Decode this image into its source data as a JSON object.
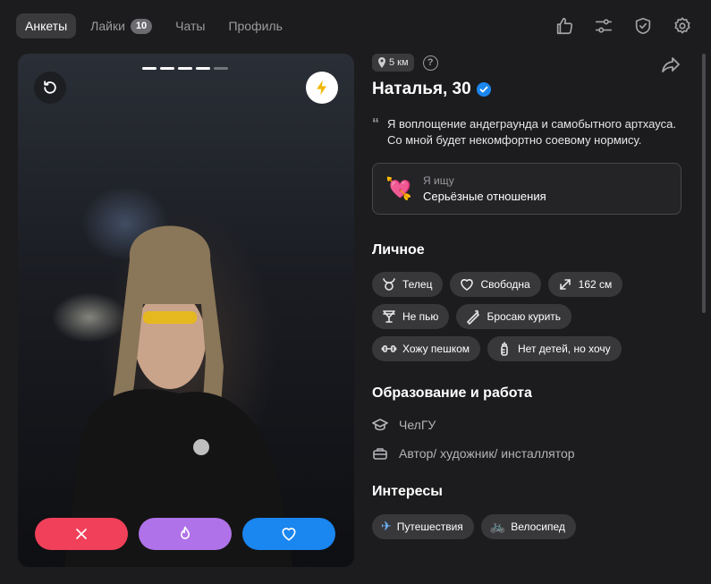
{
  "nav": {
    "tabs": [
      {
        "label": "Анкеты",
        "active": true
      },
      {
        "label": "Лайки",
        "badge": "10"
      },
      {
        "label": "Чаты"
      },
      {
        "label": "Профиль"
      }
    ],
    "icons": [
      "thumbs-up-icon",
      "sliders-icon",
      "shield-check-icon",
      "gear-icon"
    ]
  },
  "photo": {
    "progress_total": 5,
    "progress_current": 4
  },
  "profile": {
    "distance": "5 км",
    "name": "Наталья, 30",
    "verified": true,
    "bio": "Я воплощение андеграунда и самобытного артхауса. Со мной будет некомфортно соевому нормису.",
    "looking": {
      "label": "Я ищу",
      "value": "Серьёзные отношения"
    }
  },
  "personal": {
    "title": "Личное",
    "items": [
      {
        "label": "Телец",
        "icon": "taurus-icon"
      },
      {
        "label": "Свободна",
        "icon": "heart-outline-icon"
      },
      {
        "label": "162 см",
        "icon": "expand-icon"
      },
      {
        "label": "Не пью",
        "icon": "glass-icon"
      },
      {
        "label": "Бросаю курить",
        "icon": "cigarette-icon"
      },
      {
        "label": "Хожу пешком",
        "icon": "dumbbell-icon"
      },
      {
        "label": "Нет детей, но хочу",
        "icon": "baby-bottle-icon"
      }
    ]
  },
  "work": {
    "title": "Образование и работа",
    "education": "ЧелГУ",
    "job": "Автор/ художник/ инсталлятор"
  },
  "interests": {
    "title": "Интересы",
    "items": [
      {
        "label": "Путешествия",
        "emoji": "✈️"
      },
      {
        "label": "Велосипед",
        "emoji": "🚲"
      }
    ]
  },
  "colors": {
    "dislike": "#f0405a",
    "superlike": "#b072e8",
    "like": "#1a86f0",
    "verified": "#1a86f0"
  }
}
